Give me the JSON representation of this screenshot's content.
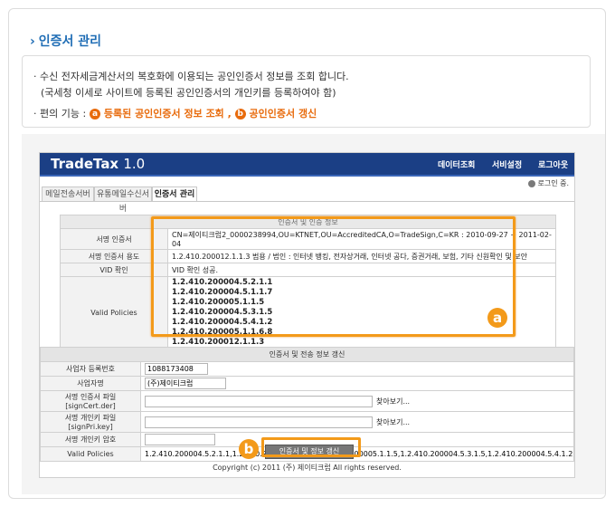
{
  "page": {
    "title": "인증서 관리",
    "info_line1": "· 수신 전자세금계산서의 복호화에 이용되는 공인인증서 정보를 조회 합니다.",
    "info_line2": "(국세청 이세로 사이트에 등록된 공인인증서의 개인키를 등록하여야 함)",
    "info_label": "· 편의 기능 :",
    "feature_a": "등록된 공인인증서 정보 조회",
    "feature_sep": ",",
    "feature_b": "공인인증서 갱신",
    "circle_a": "a",
    "circle_b": "b"
  },
  "app": {
    "logo": "TradeTax",
    "version": "1.0",
    "menu": [
      "데이터조회",
      "서비설정",
      "로그아웃"
    ],
    "login_text": "로그인 중.",
    "tabs": [
      "메일전송서버",
      "유통메일수신서버",
      "인증서 관리"
    ],
    "active_tab": 2
  },
  "cert_info": {
    "header": "인증서 및 인증 정보",
    "rows": [
      {
        "label": "서명 인증서",
        "value": "CN=제이티크럽2_0000238994,OU=KTNET,OU=AccreditedCA,O=TradeSign,C=KR : 2010-09-27 ~ 2011-02-04"
      },
      {
        "label": "서명 인증서 용도",
        "value": "1.2.410.200012.1.1.3 범용 / 법인 : 인터넷 뱅킹, 전자상거래, 인터넷 공다, 증권거래, 보험, 기타 신원확인 및 보안"
      },
      {
        "label": "VID 확인",
        "value": "VID 확인 성공."
      }
    ],
    "policies_label": "Valid Policies",
    "policies": [
      "1.2.410.200004.5.2.1.1",
      "1.2.410.200004.5.1.1.7",
      "1.2.410.200005.1.1.5",
      "1.2.410.200004.5.3.1.5",
      "1.2.410.200004.5.4.1.2",
      "1.2.410.200005.1.1.6.8",
      "1.2.410.200012.1.1.3"
    ]
  },
  "renew_form": {
    "header": "인증서 및 전송 정보 갱신",
    "biz_no_label": "사업자 등록번호",
    "biz_no_value": "1088173408",
    "company_label": "사업자명",
    "company_value": "(주)제이티크럽",
    "sign_cert_label": "서명 인증서 파일[signCert.der]",
    "sign_key_label": "서명 개인키 파일[signPri.key]",
    "browse_label": "찾아보기...",
    "password_label": "서명 개인키 암호",
    "policies_label": "Valid Policies",
    "policies_value": "1.2.410.200004.5.2.1.1,1.2.410.200004.5.1.1.7,1.2.410.200005.1.1.5,1.2.410.200004.5.3.1.5,1.2.410.200004.5.4.1.2,1.2.410.2",
    "submit_label": "인증서 및 정보 갱신"
  },
  "footer": {
    "copyright": "Copyright (c) 2011 (주) 제이티크럽 All rights reserved."
  },
  "colors": {
    "accent_orange": "#f39a1a",
    "title_blue": "#1f6db5",
    "header_navy": "#1b3f85"
  }
}
